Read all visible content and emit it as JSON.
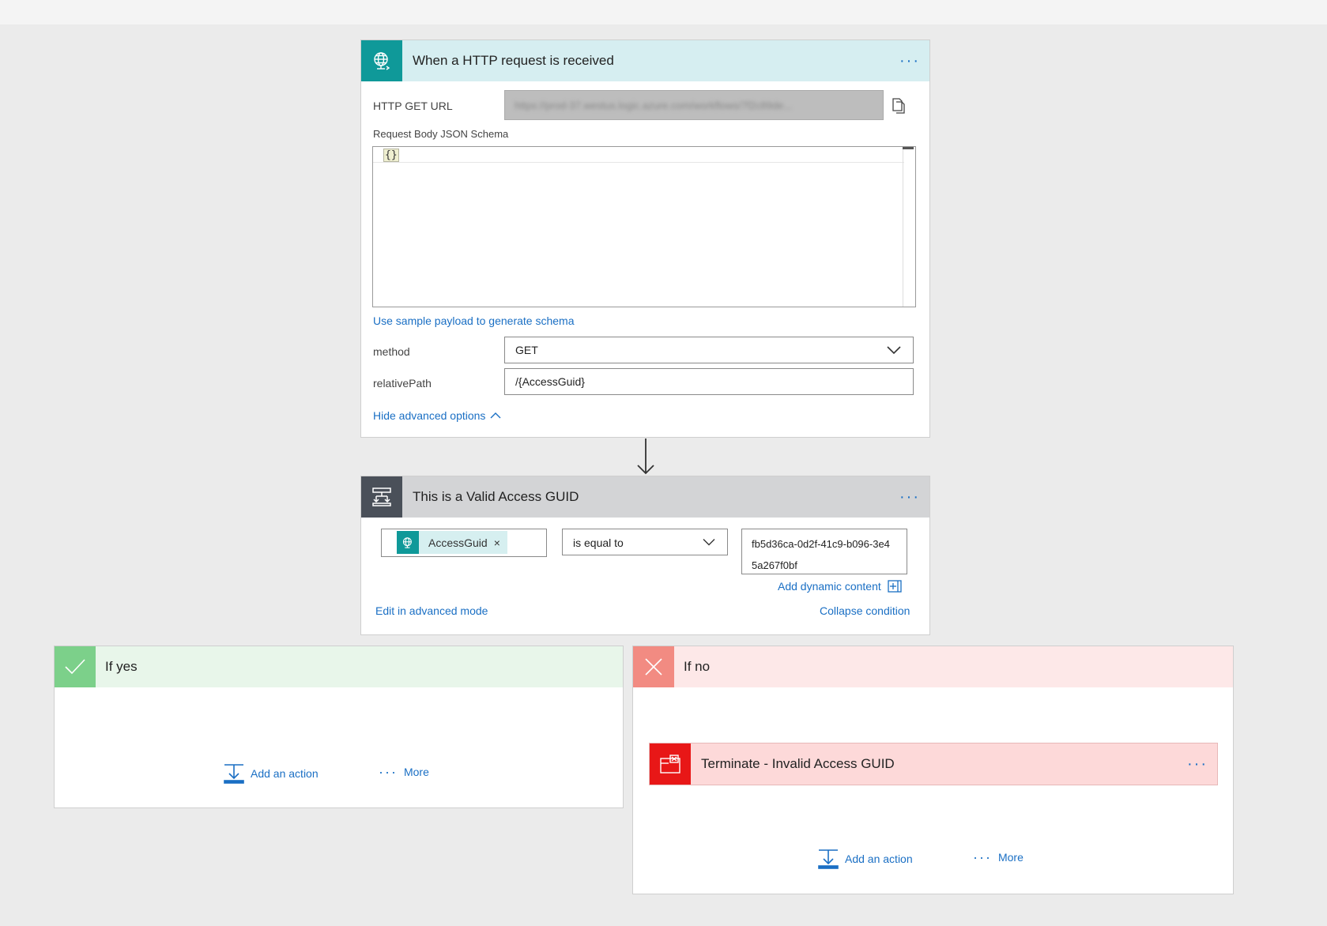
{
  "trigger": {
    "title": "When a HTTP request is received",
    "more_label": "···",
    "http_get_url_label": "HTTP GET URL",
    "http_get_url_value": "https://prod-37.westus.logic.azure.com/workflows/7f2c89de...",
    "schema_label": "Request Body JSON Schema",
    "schema_value": "{}",
    "sample_payload_link": "Use sample payload to generate schema",
    "method_label": "method",
    "method_value": "GET",
    "relative_path_label": "relativePath",
    "relative_path_value": "/{AccessGuid}",
    "hide_advanced_link": "Hide advanced options",
    "icon": "http-globe-icon",
    "accent": "#0f9999",
    "header_bg": "#d6eef1"
  },
  "condition": {
    "title": "This is a Valid Access GUID",
    "more_label": "···",
    "token_label": "AccessGuid",
    "token_remove": "×",
    "operator_value": "is equal to",
    "compare_value": "fb5d36ca-0d2f-41c9-b096-3e45a267f0bf",
    "add_dynamic_link": "Add dynamic content",
    "edit_advanced_link": "Edit in advanced mode",
    "collapse_link": "Collapse condition",
    "icon": "condition-icon",
    "accent": "#4a5059",
    "header_bg": "#d3d4d6"
  },
  "branch_yes": {
    "title": "If yes",
    "add_action_label": "Add an action",
    "more_label": "More",
    "accent": "#7cd08a",
    "header_bg": "#e8f6ea"
  },
  "branch_no": {
    "title": "If no",
    "add_action_label": "Add an action",
    "more_label": "More",
    "accent": "#f28b82",
    "header_bg": "#fde8e8",
    "terminate": {
      "title": "Terminate - Invalid Access GUID",
      "more_label": "···",
      "icon": "terminate-icon",
      "accent": "#e81717"
    }
  }
}
